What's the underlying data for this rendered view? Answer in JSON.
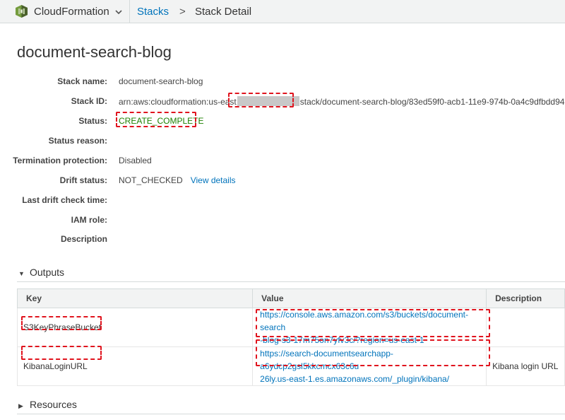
{
  "nav": {
    "service": "CloudFormation",
    "breadcrumb_stacks": "Stacks",
    "breadcrumb_arrow": ">",
    "breadcrumb_current": "Stack Detail"
  },
  "page": {
    "title": "document-search-blog"
  },
  "details": {
    "stack_name_label": "Stack name:",
    "stack_name": "document-search-blog",
    "stack_id_label": "Stack ID:",
    "stack_id_prefix": "arn:aws:cloudformation:us-east",
    "stack_id_suffix": "stack/document-search-blog/83ed59f0-acb1-11e9-974b-0a4c9dfbdd94",
    "status_label": "Status:",
    "status": "CREATE_COMPLETE",
    "status_reason_label": "Status reason:",
    "termination_label": "Termination protection:",
    "termination": "Disabled",
    "drift_label": "Drift status:",
    "drift": "NOT_CHECKED",
    "drift_link": "View details",
    "last_drift_label": "Last drift check time:",
    "iam_label": "IAM role:",
    "description_label": "Description"
  },
  "outputs": {
    "title": "Outputs",
    "columns": [
      "Key",
      "Value",
      "Description"
    ],
    "rows": [
      {
        "key": "S3KeyPhraseBucket",
        "value_line1": "https://console.aws.amazon.com/s3/buckets/document-search",
        "value_line2": "-blog-s3-17m75on7yfv3c/?region=us-east-1",
        "description": ""
      },
      {
        "key": "KibanaLoginURL",
        "value_line1": "https://search-documentsearchapp-a6ydcp2gsl5kkcmcx63c6u",
        "value_line2": "26ly.us-east-1.es.amazonaws.com/_plugin/kibana/",
        "description": "Kibana login URL"
      }
    ]
  },
  "resources": {
    "title": "Resources"
  },
  "colors": {
    "link": "#0073bb",
    "status_ok": "#1d8102",
    "highlight": "#e0141e"
  },
  "icons": {
    "service": "cloudformation-icon",
    "caret": "chevron-down-icon",
    "expanded": "triangle-down-icon",
    "collapsed": "triangle-right-icon"
  }
}
